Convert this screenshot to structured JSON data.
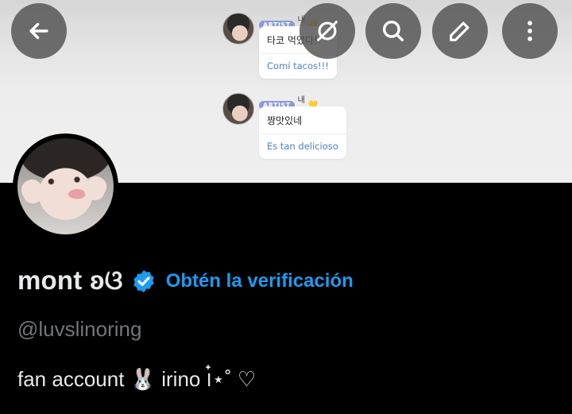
{
  "banner": {
    "messages": [
      {
        "tag": "ARTIST",
        "sender": "내꺼",
        "heart": "💛",
        "original": "타코 먹었다!!",
        "translation": "Comí tacos!!!"
      },
      {
        "tag": "ARTIST",
        "sender": "내꺼",
        "heart": "💛",
        "original": "짱맛있네",
        "translation": "Es tan delicioso"
      }
    ]
  },
  "toolbar": {
    "back_icon": "arrow-left-icon",
    "grok_icon": "grok-icon",
    "search_icon": "search-icon",
    "edit_icon": "edit-icon",
    "more_icon": "more-vertical-icon"
  },
  "profile": {
    "display_name": "mont ʚଓ",
    "verify_link": "Obtén la verificación",
    "handle": "@luvslinoring",
    "bio": "fan account 🐰 irino ౹๋⋆˚ ♡"
  },
  "colors": {
    "accent": "#1d9bf0",
    "background": "#000000",
    "muted": "#71767b"
  }
}
